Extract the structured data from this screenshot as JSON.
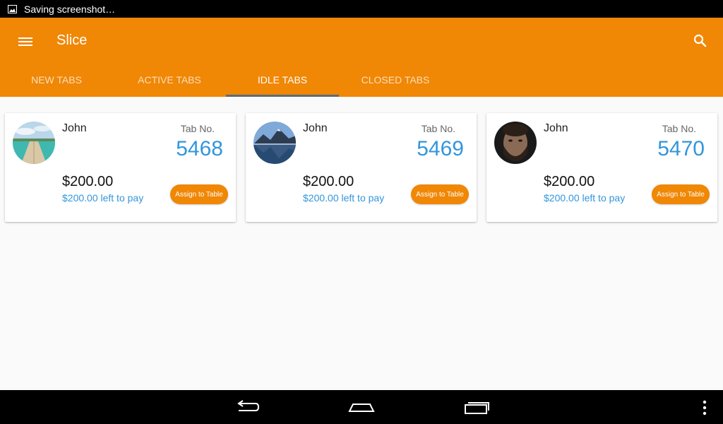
{
  "status_bar": {
    "notification_text": "Saving screenshot…"
  },
  "app_bar": {
    "title": "Slice",
    "color": "#f08705",
    "menu_icon": "menu-icon",
    "search_icon": "search-icon"
  },
  "tabs": [
    {
      "label": "NEW TABS",
      "active": false
    },
    {
      "label": "ACTIVE TABS",
      "active": false
    },
    {
      "label": "IDLE TABS",
      "active": true
    },
    {
      "label": "CLOSED TABS",
      "active": false
    }
  ],
  "cards": [
    {
      "name": "John",
      "tab_label": "Tab No.",
      "tab_no": "5468",
      "amount": "$200.00",
      "left_to_pay": "$200.00 left to pay",
      "button": "Assign to Table",
      "avatar": "beach-pier-avatar"
    },
    {
      "name": "John",
      "tab_label": "Tab No.",
      "tab_no": "5469",
      "amount": "$200.00",
      "left_to_pay": "$200.00 left to pay",
      "button": "Assign to Table",
      "avatar": "mountain-lake-avatar"
    },
    {
      "name": "John",
      "tab_label": "Tab No.",
      "tab_no": "5470",
      "amount": "$200.00",
      "left_to_pay": "$200.00 left to pay",
      "button": "Assign to Table",
      "avatar": "bearded-man-avatar"
    }
  ],
  "nav_bar": {
    "back_icon": "back-icon",
    "home_icon": "home-icon",
    "recents_icon": "recents-icon",
    "overflow_icon": "overflow-menu-icon"
  }
}
